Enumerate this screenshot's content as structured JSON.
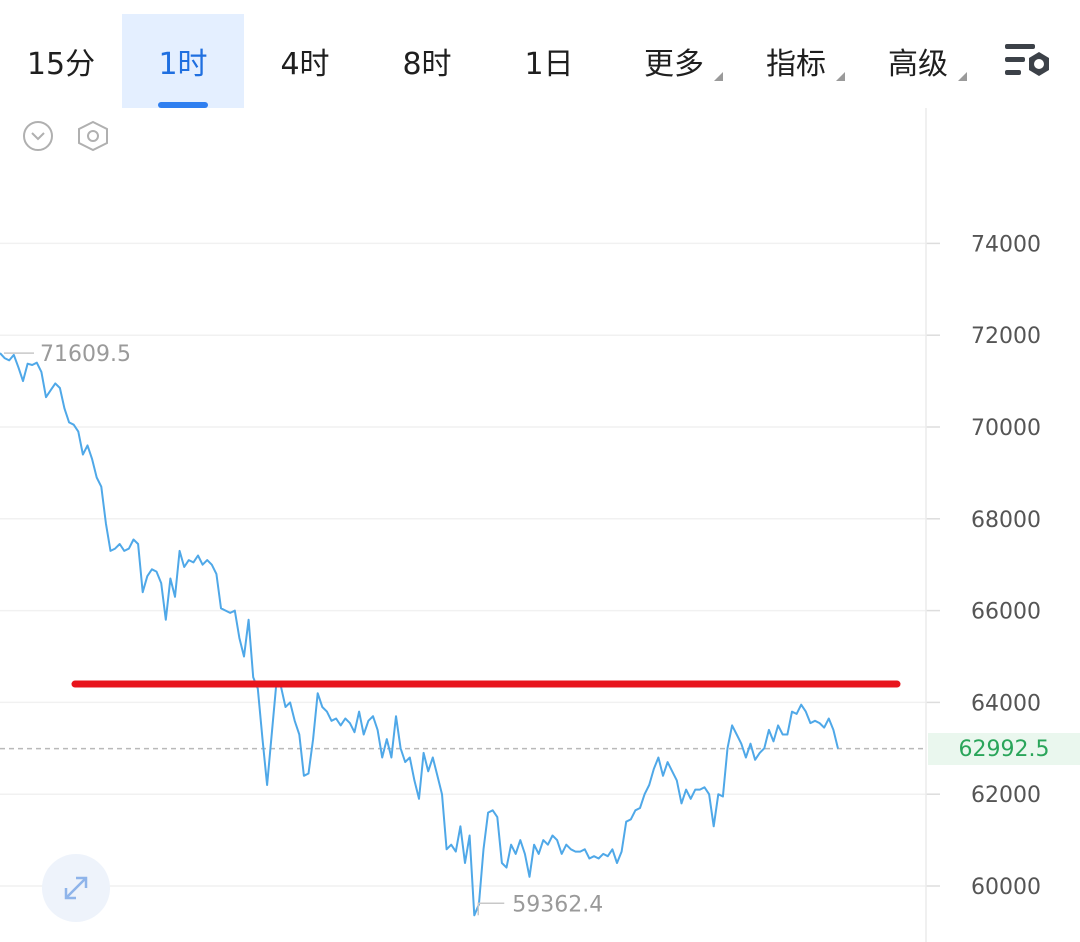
{
  "tabs": [
    {
      "label": "15分",
      "active": false
    },
    {
      "label": "1时",
      "active": true
    },
    {
      "label": "4时",
      "active": false
    },
    {
      "label": "8时",
      "active": false
    },
    {
      "label": "1日",
      "active": false
    },
    {
      "label": "更多",
      "active": false,
      "dropdown": true
    },
    {
      "label": "指标",
      "active": false,
      "dropdown": true
    },
    {
      "label": "高级",
      "active": false,
      "dropdown": true
    }
  ],
  "icons": {
    "settings": "settings-list-gear-icon",
    "collapse": "chevron-down-circle-icon",
    "hex": "hexagon-settings-icon",
    "expand": "expand-arrows-icon"
  },
  "colors": {
    "accent": "#2f7ff0",
    "line": "#4fa8e8",
    "level_line": "#e8141c",
    "price_up": "#2aa55a"
  },
  "chart_data": {
    "type": "line",
    "yticks": [
      60000,
      62000,
      64000,
      66000,
      68000,
      70000,
      72000,
      74000
    ],
    "ytick_labels": [
      "60000",
      "62000",
      "64000",
      "66000",
      "68000",
      "70000",
      "72000",
      "74000"
    ],
    "ylim": [
      59000,
      76000
    ],
    "grid": true,
    "series": [
      {
        "values": [
          71609.5,
          71500,
          71450,
          71570,
          71300,
          71000,
          71380,
          71350,
          71400,
          71200,
          70650,
          70800,
          70950,
          70850,
          70400,
          70100,
          70050,
          69900,
          69400,
          69600,
          69300,
          68900,
          68700,
          67900,
          67300,
          67350,
          67450,
          67300,
          67350,
          67550,
          67450,
          66400,
          66750,
          66900,
          66850,
          66600,
          65800,
          66700,
          66300,
          67300,
          66950,
          67100,
          67050,
          67200,
          67000,
          67100,
          67000,
          66800,
          66050,
          66000,
          65950,
          66000,
          65400,
          65000,
          65800,
          64550,
          64300,
          63200,
          62200,
          63300,
          64400,
          64350,
          63900,
          64000,
          63600,
          63300,
          62400,
          62450,
          63200,
          64200,
          63900,
          63800,
          63600,
          63650,
          63500,
          63650,
          63550,
          63350,
          63800,
          63300,
          63600,
          63700,
          63400,
          62800,
          63200,
          62800,
          63700,
          63000,
          62700,
          62800,
          62300,
          61900,
          62900,
          62500,
          62800,
          62400,
          62000,
          60800,
          60900,
          60750,
          61300,
          60500,
          61100,
          59362.4,
          59600,
          60800,
          61600,
          61650,
          61500,
          60500,
          60400,
          60900,
          60700,
          61000,
          60700,
          60200,
          60900,
          60700,
          61000,
          60900,
          61100,
          61000,
          60700,
          60900,
          60800,
          60750,
          60750,
          60800,
          60600,
          60650,
          60600,
          60700,
          60650,
          60800,
          60500,
          60750,
          61400,
          61450,
          61650,
          61700,
          62000,
          62200,
          62550,
          62800,
          62400,
          62700,
          62500,
          62300,
          61800,
          62100,
          61900,
          62100,
          62100,
          62150,
          62000,
          61300,
          62000,
          61950,
          63000,
          63500,
          63300,
          63100,
          62800,
          63100,
          62750,
          62900,
          63000,
          63400,
          63150,
          63500,
          63300,
          63300,
          63800,
          63750,
          63950,
          63800,
          63550,
          63600,
          63550,
          63450,
          63650,
          63400,
          62992.5
        ]
      }
    ],
    "max_label": "71609.5",
    "min_label": "59362.4",
    "current_price_label": "62992.5",
    "level_line_value": 64400
  }
}
